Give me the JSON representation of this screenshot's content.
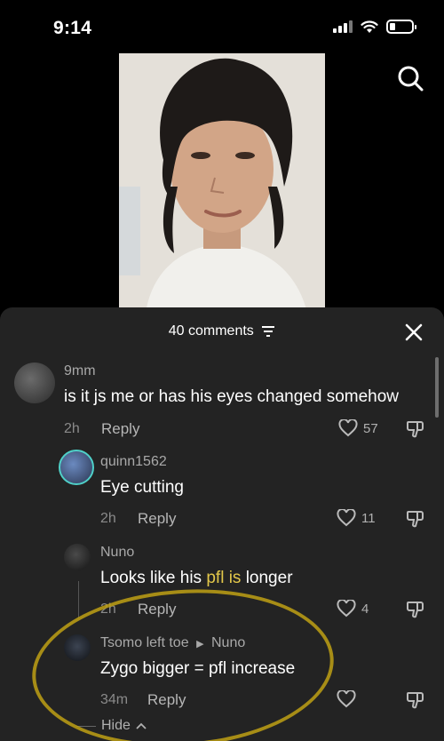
{
  "status_bar": {
    "time": "9:14"
  },
  "sheet": {
    "count_label": "40 comments",
    "comments": [
      {
        "username": "9mm",
        "text": "is it js me or has his eyes changed somehow",
        "time": "2h",
        "reply": "Reply",
        "likes": "57"
      },
      {
        "username": "quinn1562",
        "text": "Eye cutting",
        "time": "2h",
        "reply": "Reply",
        "likes": "11"
      },
      {
        "username": "Nuno",
        "text_before": "Looks like his ",
        "text_highlight": "pfl is",
        "text_after": " longer",
        "time": "2h",
        "reply": "Reply",
        "likes": "4"
      },
      {
        "username": "Tsomo left toe",
        "reply_to": "Nuno",
        "text": "Zygo bigger = pfl increase",
        "time": "34m",
        "reply": "Reply",
        "likes": ""
      }
    ],
    "hide_label": "Hide"
  },
  "icons": {
    "search": "search-icon",
    "close": "close-icon",
    "filter": "filter-icon",
    "heart": "heart-icon",
    "dislike": "dislike-icon"
  }
}
